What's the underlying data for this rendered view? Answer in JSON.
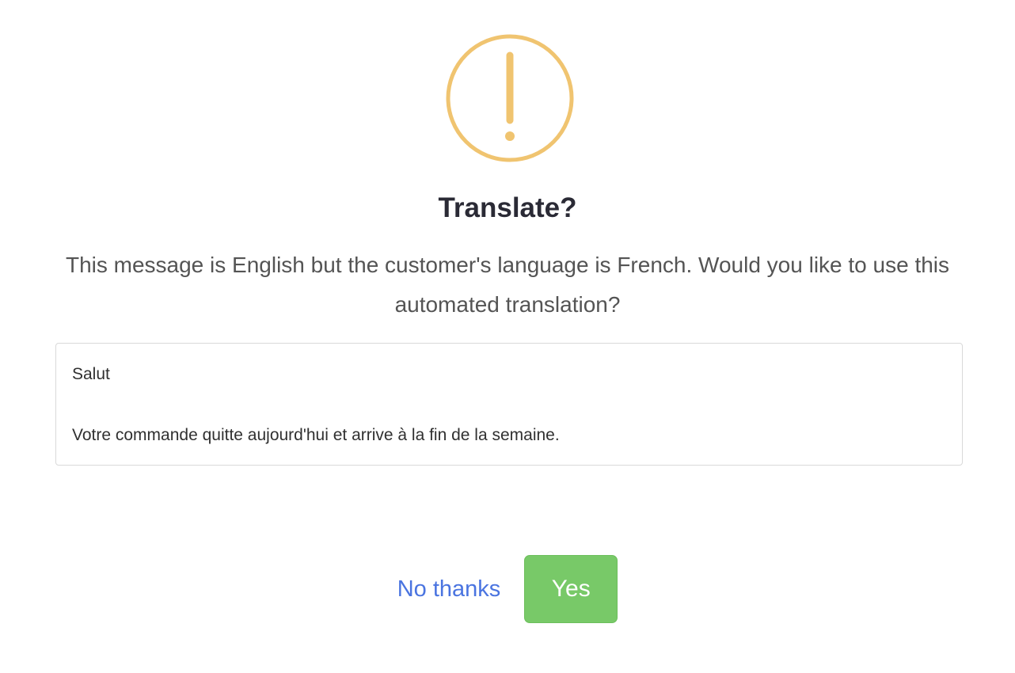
{
  "dialog": {
    "icon": "warning-icon",
    "icon_color": "#f0c470",
    "title": "Translate?",
    "message": "This message is English but the customer's language is French. Would you like to use this automated translation?",
    "translation": {
      "line1": "Salut",
      "line2": "Votre commande quitte aujourd'hui et arrive à la fin de la semaine."
    },
    "actions": {
      "cancel_label": "No thanks",
      "confirm_label": "Yes",
      "link_color": "#4a74e0",
      "confirm_color": "#78c968"
    }
  }
}
